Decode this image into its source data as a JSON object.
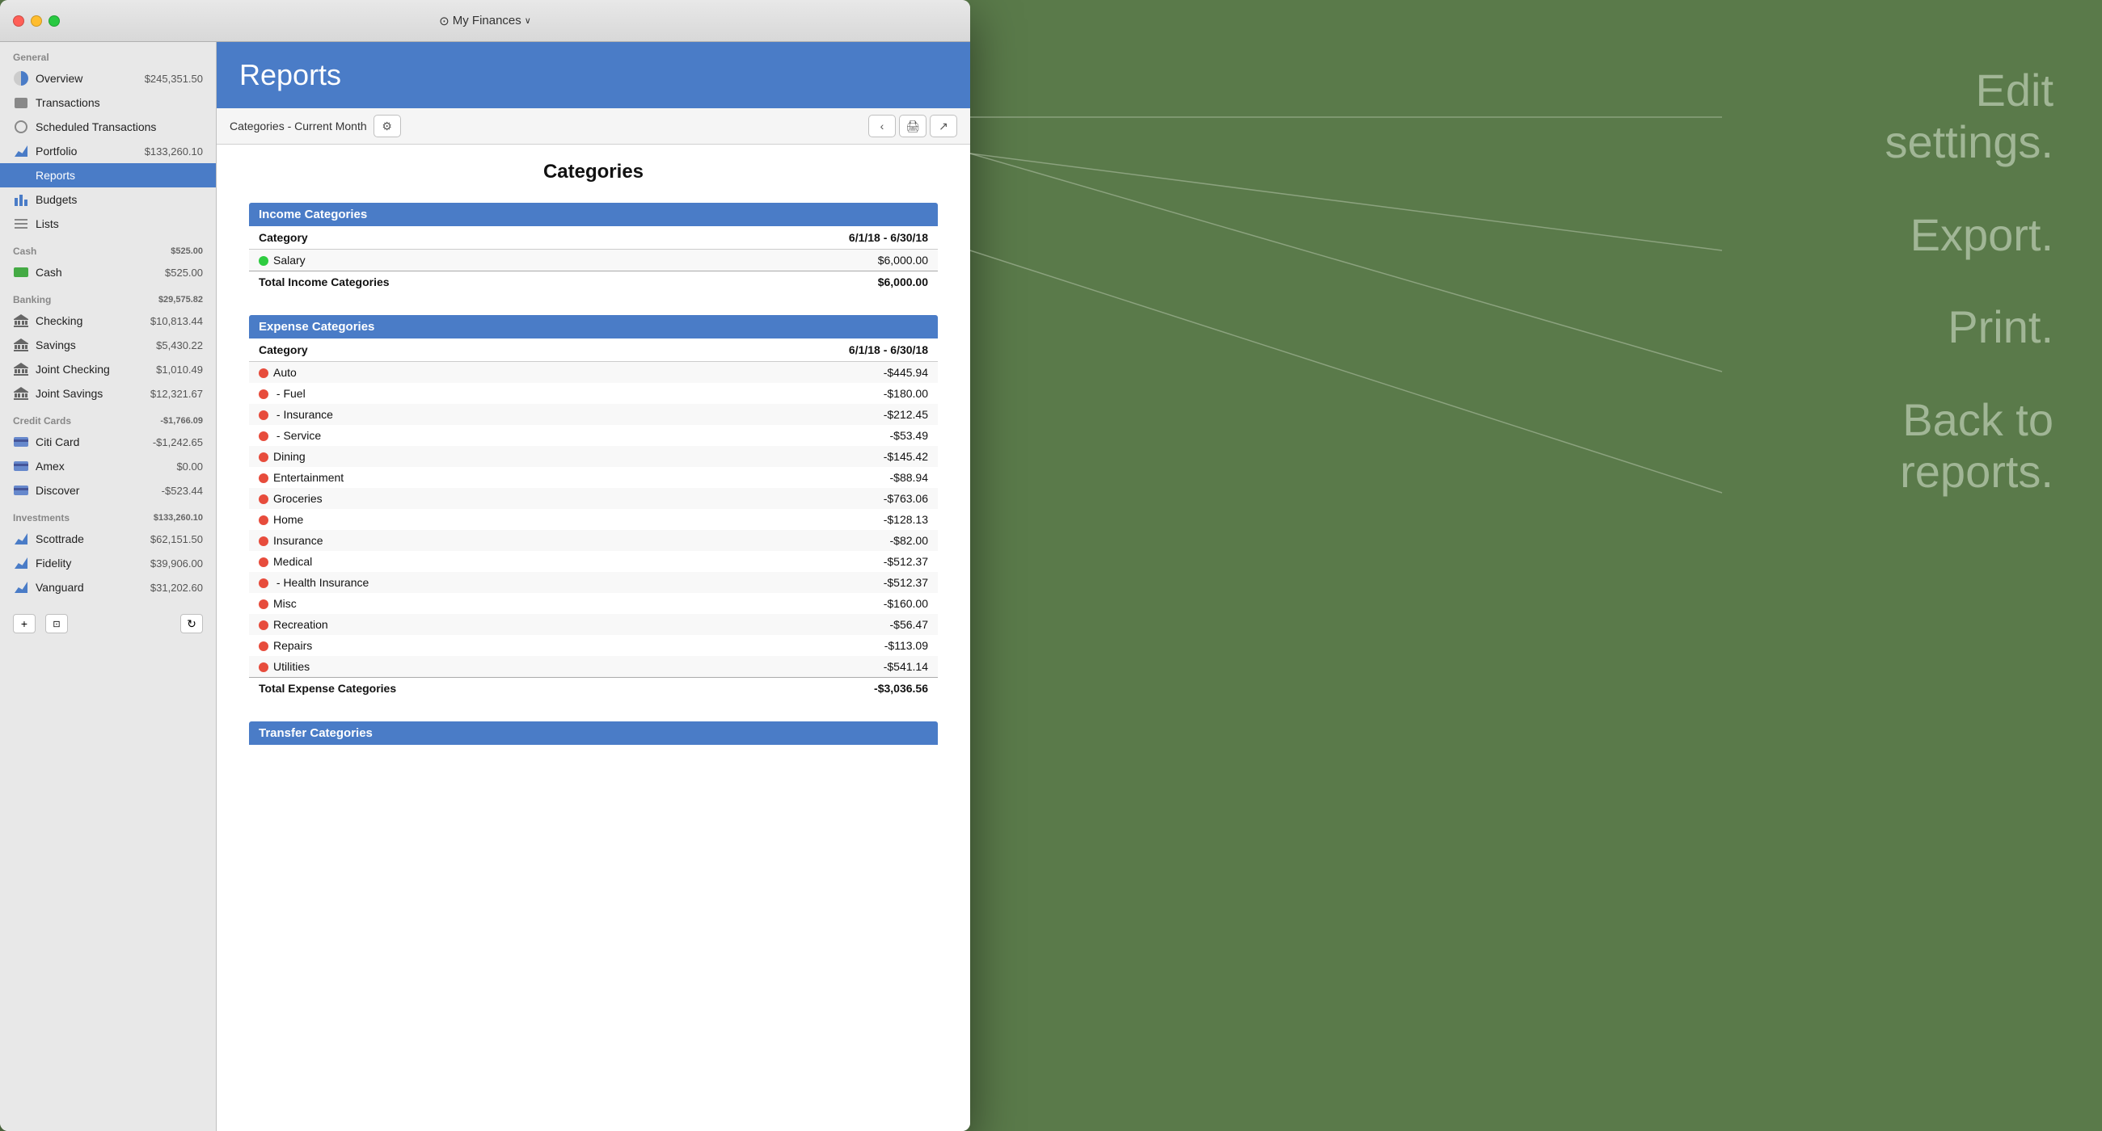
{
  "window": {
    "title": "My Finances",
    "title_icon": "coin-icon"
  },
  "sidebar": {
    "general_label": "General",
    "items_general": [
      {
        "id": "overview",
        "label": "Overview",
        "amount": "$245,351.50",
        "icon": "overview-icon"
      },
      {
        "id": "transactions",
        "label": "Transactions",
        "amount": "",
        "icon": "transactions-icon"
      },
      {
        "id": "scheduled",
        "label": "Scheduled Transactions",
        "amount": "",
        "icon": "scheduled-icon"
      },
      {
        "id": "portfolio",
        "label": "Portfolio",
        "amount": "$133,260.10",
        "icon": "portfolio-icon"
      },
      {
        "id": "reports",
        "label": "Reports",
        "amount": "",
        "icon": "reports-icon",
        "active": true
      },
      {
        "id": "budgets",
        "label": "Budgets",
        "amount": "",
        "icon": "budgets-icon"
      },
      {
        "id": "lists",
        "label": "Lists",
        "amount": "",
        "icon": "lists-icon"
      }
    ],
    "cash_label": "Cash",
    "cash_total": "$525.00",
    "items_cash": [
      {
        "id": "cash",
        "label": "Cash",
        "amount": "$525.00",
        "icon": "cash-icon"
      }
    ],
    "banking_label": "Banking",
    "banking_total": "$29,575.82",
    "items_banking": [
      {
        "id": "checking",
        "label": "Checking",
        "amount": "$10,813.44",
        "icon": "bank-icon"
      },
      {
        "id": "savings",
        "label": "Savings",
        "amount": "$5,430.22",
        "icon": "bank-icon"
      },
      {
        "id": "joint-checking",
        "label": "Joint Checking",
        "amount": "$1,010.49",
        "icon": "bank-icon"
      },
      {
        "id": "joint-savings",
        "label": "Joint Savings",
        "amount": "$12,321.67",
        "icon": "bank-icon"
      }
    ],
    "credit_label": "Credit Cards",
    "credit_total": "-$1,766.09",
    "items_credit": [
      {
        "id": "citi",
        "label": "Citi Card",
        "amount": "-$1,242.65",
        "icon": "card-icon"
      },
      {
        "id": "amex",
        "label": "Amex",
        "amount": "$0.00",
        "icon": "card-icon"
      },
      {
        "id": "discover",
        "label": "Discover",
        "amount": "-$523.44",
        "icon": "card-icon"
      }
    ],
    "investments_label": "Investments",
    "investments_total": "$133,260.10",
    "items_investments": [
      {
        "id": "scottrade",
        "label": "Scottrade",
        "amount": "$62,151.50",
        "icon": "invest-icon"
      },
      {
        "id": "fidelity",
        "label": "Fidelity",
        "amount": "$39,906.00",
        "icon": "invest-icon"
      },
      {
        "id": "vanguard",
        "label": "Vanguard",
        "amount": "$31,202.60",
        "icon": "invest-icon"
      }
    ]
  },
  "header": {
    "title": "Reports"
  },
  "toolbar": {
    "report_name": "Categories - Current Month",
    "gear_label": "⚙",
    "back_label": "‹",
    "print_label": "🖨",
    "export_label": "↗"
  },
  "report": {
    "title": "Categories",
    "income_section_title": "Income Categories",
    "income_col_category": "Category",
    "income_col_date": "6/1/18 - 6/30/18",
    "income_rows": [
      {
        "dot": "green",
        "name": "Salary",
        "amount": "$6,000.00"
      }
    ],
    "income_total_label": "Total Income Categories",
    "income_total_amount": "$6,000.00",
    "expense_section_title": "Expense Categories",
    "expense_col_category": "Category",
    "expense_col_date": "6/1/18 - 6/30/18",
    "expense_rows": [
      {
        "dot": "red",
        "name": "Auto",
        "amount": "-$445.94"
      },
      {
        "dot": "red",
        "name": " - Fuel",
        "amount": "-$180.00"
      },
      {
        "dot": "red",
        "name": " - Insurance",
        "amount": "-$212.45"
      },
      {
        "dot": "red",
        "name": " - Service",
        "amount": "-$53.49"
      },
      {
        "dot": "red",
        "name": "Dining",
        "amount": "-$145.42"
      },
      {
        "dot": "red",
        "name": "Entertainment",
        "amount": "-$88.94"
      },
      {
        "dot": "red",
        "name": "Groceries",
        "amount": "-$763.06"
      },
      {
        "dot": "red",
        "name": "Home",
        "amount": "-$128.13"
      },
      {
        "dot": "red",
        "name": "Insurance",
        "amount": "-$82.00"
      },
      {
        "dot": "red",
        "name": "Medical",
        "amount": "-$512.37"
      },
      {
        "dot": "red",
        "name": " - Health Insurance",
        "amount": "-$512.37"
      },
      {
        "dot": "red",
        "name": "Misc",
        "amount": "-$160.00"
      },
      {
        "dot": "red",
        "name": "Recreation",
        "amount": "-$56.47"
      },
      {
        "dot": "red",
        "name": "Repairs",
        "amount": "-$113.09"
      },
      {
        "dot": "red",
        "name": "Utilities",
        "amount": "-$541.14"
      }
    ],
    "expense_total_label": "Total Expense Categories",
    "expense_total_amount": "-$3,036.56",
    "transfer_section_title": "Transfer Categories"
  },
  "annotations": {
    "edit_settings": "Edit\nsettings.",
    "export": "Export.",
    "print": "Print.",
    "back_to_reports": "Back to\nreports."
  }
}
